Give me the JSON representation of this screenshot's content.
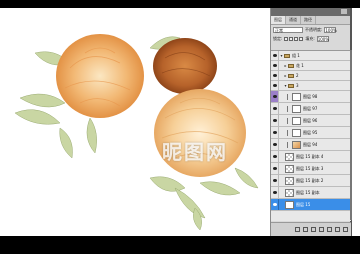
{
  "panel": {
    "tabs": [
      {
        "label": "图层",
        "active": true
      },
      {
        "label": "通道",
        "active": false
      },
      {
        "label": "路径",
        "active": false
      }
    ],
    "blend_mode": "正常",
    "opacity_label": "不透明度:",
    "opacity_value": "100%",
    "lock_label": "锁定:",
    "fill_label": "填充:",
    "fill_value": "100%"
  },
  "layers": [
    {
      "name": "组 1",
      "type": "group",
      "expanded": true
    },
    {
      "name": "花 1",
      "type": "group",
      "expanded": false
    },
    {
      "name": "2",
      "type": "group",
      "expanded": false
    },
    {
      "name": "3",
      "type": "group",
      "expanded": true
    },
    {
      "name": "图层 98",
      "type": "layer",
      "selected_eye": true
    },
    {
      "name": "图层 97",
      "type": "layer"
    },
    {
      "name": "图层 96",
      "type": "layer"
    },
    {
      "name": "图层 95",
      "type": "layer"
    },
    {
      "name": "图层 94",
      "type": "layer"
    },
    {
      "name": "图层 15 副本 4",
      "type": "layer"
    },
    {
      "name": "图层 15 副本 3",
      "type": "layer"
    },
    {
      "name": "图层 15 副本 2",
      "type": "layer"
    },
    {
      "name": "图层 15 副本",
      "type": "layer"
    },
    {
      "name": "图层 15",
      "type": "layer",
      "selected": true
    }
  ],
  "watermark": {
    "text": "昵图网"
  },
  "colors": {
    "selected": "#3a8ee8",
    "selected_eye": "#9b7fc8",
    "panel_bg": "#d9d9d9"
  }
}
